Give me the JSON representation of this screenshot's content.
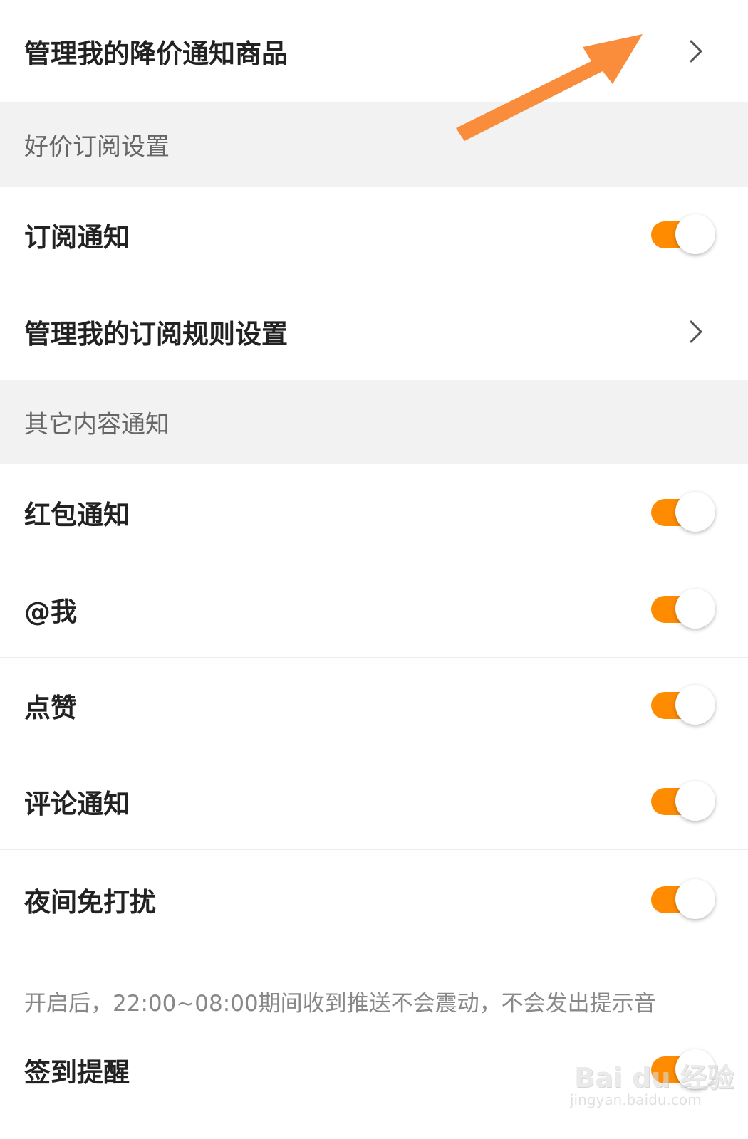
{
  "items": {
    "price_drop_manage": {
      "label": "管理我的降价通知商品"
    },
    "subscription_notify": {
      "label": "订阅通知",
      "enabled": true
    },
    "subscription_rules": {
      "label": "管理我的订阅规则设置"
    },
    "red_packet": {
      "label": "红包通知",
      "enabled": true
    },
    "mention": {
      "label": "@我",
      "enabled": true
    },
    "likes": {
      "label": "点赞",
      "enabled": true
    },
    "comments": {
      "label": "评论通知",
      "enabled": true
    },
    "night_dnd": {
      "label": "夜间免打扰",
      "enabled": true,
      "note": "开启后，22:00~08:00期间收到推送不会震动，不会发出提示音"
    },
    "checkin_reminder": {
      "label": "签到提醒",
      "enabled": true
    }
  },
  "sections": {
    "good_price": {
      "title": "好价订阅设置"
    },
    "other_content": {
      "title": "其它内容通知"
    }
  },
  "colors": {
    "toggle_on": "#ff8b00",
    "annotation_arrow": "#f98d3c",
    "section_bg": "#f2f2f2"
  },
  "icons": {
    "row_chevron": "chevron-right-icon",
    "annotation": "arrow-annotation-icon"
  },
  "watermark": {
    "text": "Bai du 经验",
    "sub": "jingyan.baidu.com"
  }
}
